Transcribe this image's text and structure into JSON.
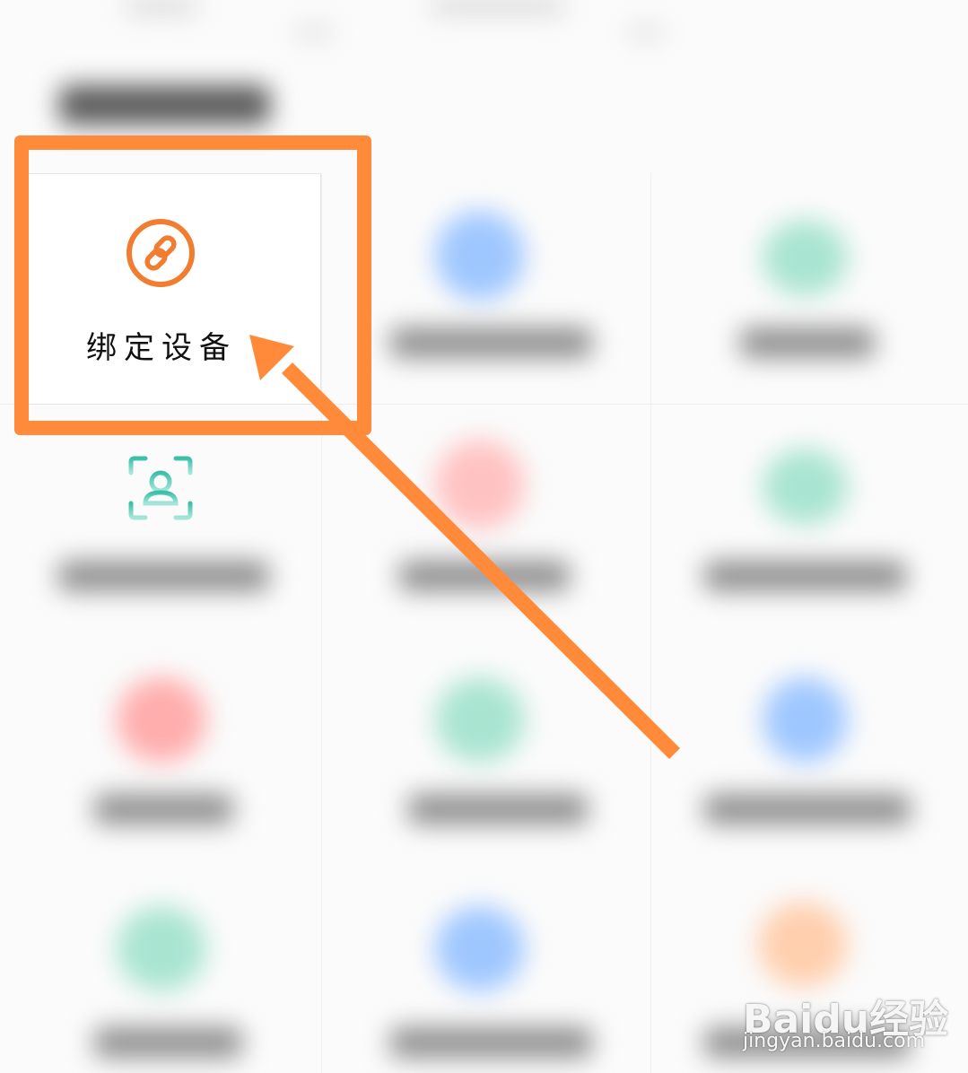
{
  "bind_device": {
    "label": "绑定设备",
    "icon": "link-icon",
    "accent": "#f07d30"
  },
  "highlight": {
    "color": "#ff8b3a"
  },
  "face_tile": {
    "icon": "face-scan-icon",
    "accent": "#3cbfa8"
  },
  "watermark": {
    "logo": "Baidu经验",
    "url": "jingyan.baidu.com"
  }
}
